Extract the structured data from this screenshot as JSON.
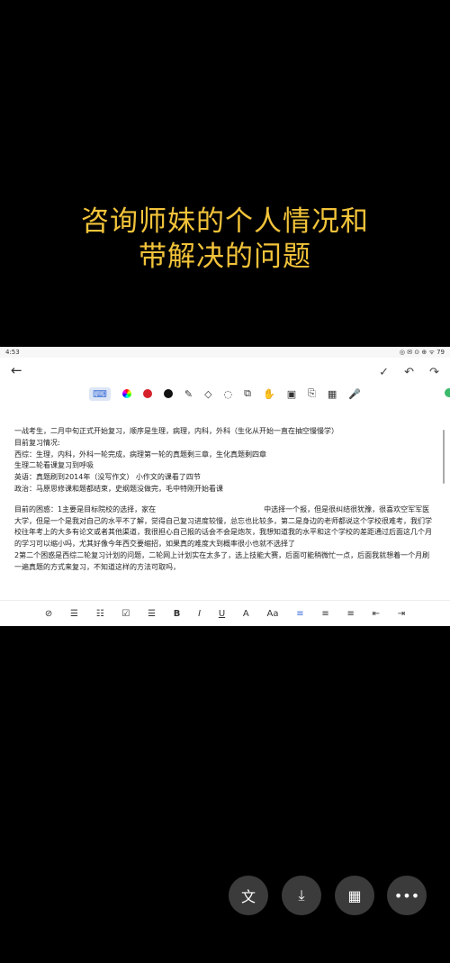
{
  "caption": {
    "line1": "咨询师妹的个人情况和",
    "line2": "带解决的问题"
  },
  "status": {
    "time": "4:53",
    "right": "◎ ✉ ⊙ ⊕ ᯤ 79"
  },
  "toolbar": {
    "back": "←",
    "check": "✓",
    "undo": "↶",
    "redo": "↷"
  },
  "tools": {
    "keyboard": "⌨",
    "pen": "✎",
    "eraser": "◇",
    "lasso": "◌",
    "crop": "⧉",
    "hand": "✋",
    "image": "▣",
    "attach": "⎘",
    "grid": "▦",
    "mic": "🎤"
  },
  "colors": {
    "red": "#d6202a",
    "black": "#111111"
  },
  "doc": {
    "line0": "一战考生，二月中旬正式开始复习，顺序是生理，病理，内科，外科（生化从开始一直在抽空慢慢学）",
    "line1": "目前复习情况:",
    "line2": "西综：生理，内科，外科一轮完成，病理第一轮的真题剩三章，生化真题剩四章",
    "line3": "生理二轮看课复习到呼吸",
    "line4": "英语：真题刷到2014年（没写作文） 小作文的课看了四节",
    "line5": "政治：马原思修课和题都结束，史纲题没做完，毛中特刚开始看课",
    "para1a": "目前的困惑：1主要是目标院校的选择，家在",
    "para1b": "中选择一个报，但是很纠结很犹豫，很喜欢空军军医大学，但是一个是我对自己的水平不了解，觉得自己复习进度较慢，总忘也比较多，第二是身边的老师都说这个学校很难考，我们学校往年考上的大多有论文或者其他渠道，我很担心自己报的话会不会是炮灰，我想知道我的水平和这个学校的差距通过后面这几个月的学习可以缩小吗，尤其好像今年西交要缩招，如果真的难度大到概率很小也就不选择了",
    "para2": "2第二个困惑是西综二轮复习计划的问题，二轮网上计划实在太多了，选上技能大赛，后面可能稍微忙一点，后面我就想着一个月刷一遍真题的方式来复习，不知道这样的方法可取吗，"
  },
  "format": {
    "checklist": "⊘",
    "bullet": "☰",
    "number": "☷",
    "todo": "☑",
    "indent": "☰",
    "bold": "B",
    "italic": "I",
    "underline": "U",
    "color": "A",
    "size": "Aa",
    "left": "≡",
    "center": "≡",
    "right": "≡",
    "outdent": "⇤",
    "indent2": "⇥"
  },
  "fabs": {
    "translate": "文",
    "download": "⤓",
    "apps": "▦",
    "more": "•••"
  }
}
